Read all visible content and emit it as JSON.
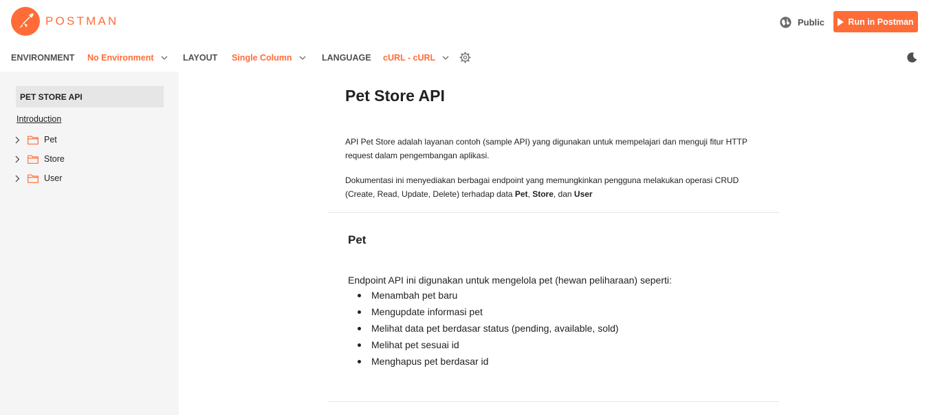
{
  "brand": {
    "name": "POSTMAN",
    "color": "#FF6C37"
  },
  "header": {
    "public_label": "Public",
    "public_icon": "globe-icon",
    "run_button_label": "Run in Postman",
    "run_button_icon": "play-icon"
  },
  "toolbar": {
    "environment_label": "ENVIRONMENT",
    "environment_value": "No Environment",
    "layout_label": "LAYOUT",
    "layout_value": "Single Column",
    "language_label": "LANGUAGE",
    "language_value": "cURL - cURL",
    "settings_icon": "gear-icon",
    "theme_icon": "moon-icon"
  },
  "sidebar": {
    "title": "PET STORE API",
    "intro_link": "Introduction",
    "folders": [
      {
        "label": "Pet"
      },
      {
        "label": "Store"
      },
      {
        "label": "User"
      }
    ]
  },
  "main": {
    "title": "Pet Store API",
    "para1": "API Pet Store adalah layanan contoh (sample API) yang digunakan untuk mempelajari dan menguji fitur HTTP request dalam pengembangan aplikasi.",
    "para2_prefix": "Dokumentasi ini menyediakan berbagai endpoint yang memungkinkan pengguna melakukan operasi CRUD (Create, Read, Update, Delete) terhadap data ",
    "para2_b1": "Pet",
    "para2_sep1": ", ",
    "para2_b2": "Store",
    "para2_sep2": ", dan ",
    "para2_b3": "User",
    "section": {
      "title": "Pet",
      "intro": "Endpoint API ini digunakan untuk mengelola pet (hewan peliharaan) seperti:",
      "bullets": [
        "Menambah pet baru",
        "Mengupdate informasi pet",
        "Melihat data pet berdasar status (pending, available, sold)",
        "Melihat pet sesuai id",
        "Menghapus pet berdasar id"
      ]
    }
  }
}
